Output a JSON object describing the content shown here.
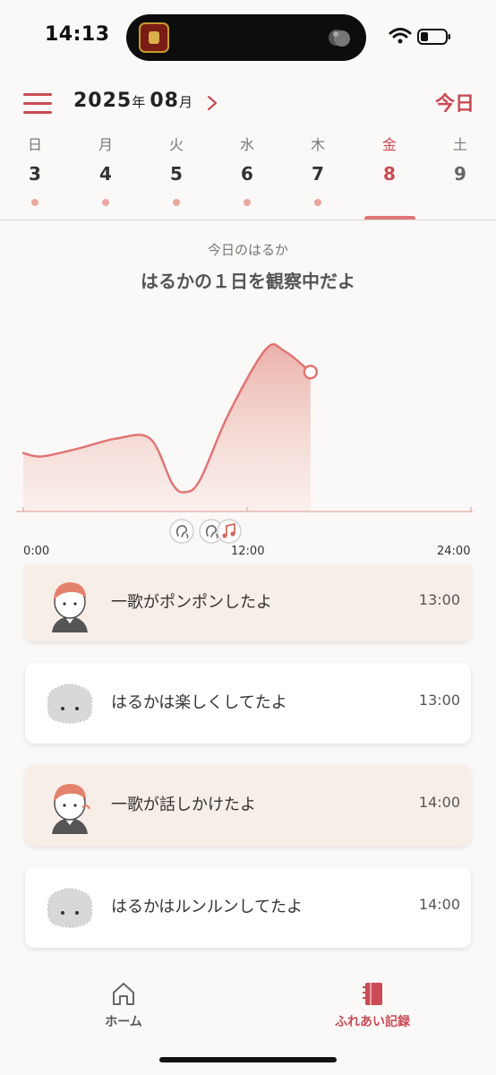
{
  "status_bar": {
    "time": "14:13"
  },
  "header": {
    "year": "2025",
    "year_suffix": "年",
    "month": "08",
    "month_suffix": "月",
    "today_label": "今日"
  },
  "week": {
    "days": [
      {
        "dow": "日",
        "date": "3"
      },
      {
        "dow": "月",
        "date": "4"
      },
      {
        "dow": "火",
        "date": "5"
      },
      {
        "dow": "水",
        "date": "6"
      },
      {
        "dow": "木",
        "date": "7"
      },
      {
        "dow": "金",
        "date": "8"
      },
      {
        "dow": "土",
        "date": "9"
      }
    ],
    "selected_index": 5
  },
  "section": {
    "subtitle": "今日のはるか",
    "title": "はるかの１日を観察中だよ"
  },
  "chart_data": {
    "type": "area",
    "x_ticks": [
      "0:00",
      "12:00",
      "24:00"
    ],
    "xlim": [
      0,
      24
    ],
    "series": [
      {
        "x": [
          0,
          1,
          3,
          5,
          6.8,
          8,
          8.7,
          9.5,
          11,
          13,
          14,
          15.4
        ],
        "y": [
          0.36,
          0.34,
          0.39,
          0.45,
          0.45,
          0.17,
          0.12,
          0.2,
          0.6,
          1.0,
          0.99,
          0.86
        ]
      }
    ],
    "accent_color": "#e07575",
    "event_icons": [
      "voice-icon",
      "voice-icon",
      "music-icon"
    ]
  },
  "events": [
    {
      "actor": "person",
      "text": "一歌がポンポンしたよ",
      "time": "13:00"
    },
    {
      "actor": "creature",
      "text": "はるかは楽しくしてたよ",
      "time": "13:00"
    },
    {
      "actor": "person",
      "text": "一歌が話しかけたよ",
      "time": "14:00"
    },
    {
      "actor": "creature",
      "text": "はるかはルンルンしてたよ",
      "time": "14:00"
    }
  ],
  "tabbar": {
    "home_label": "ホーム",
    "record_label": "ふれあい記録"
  }
}
